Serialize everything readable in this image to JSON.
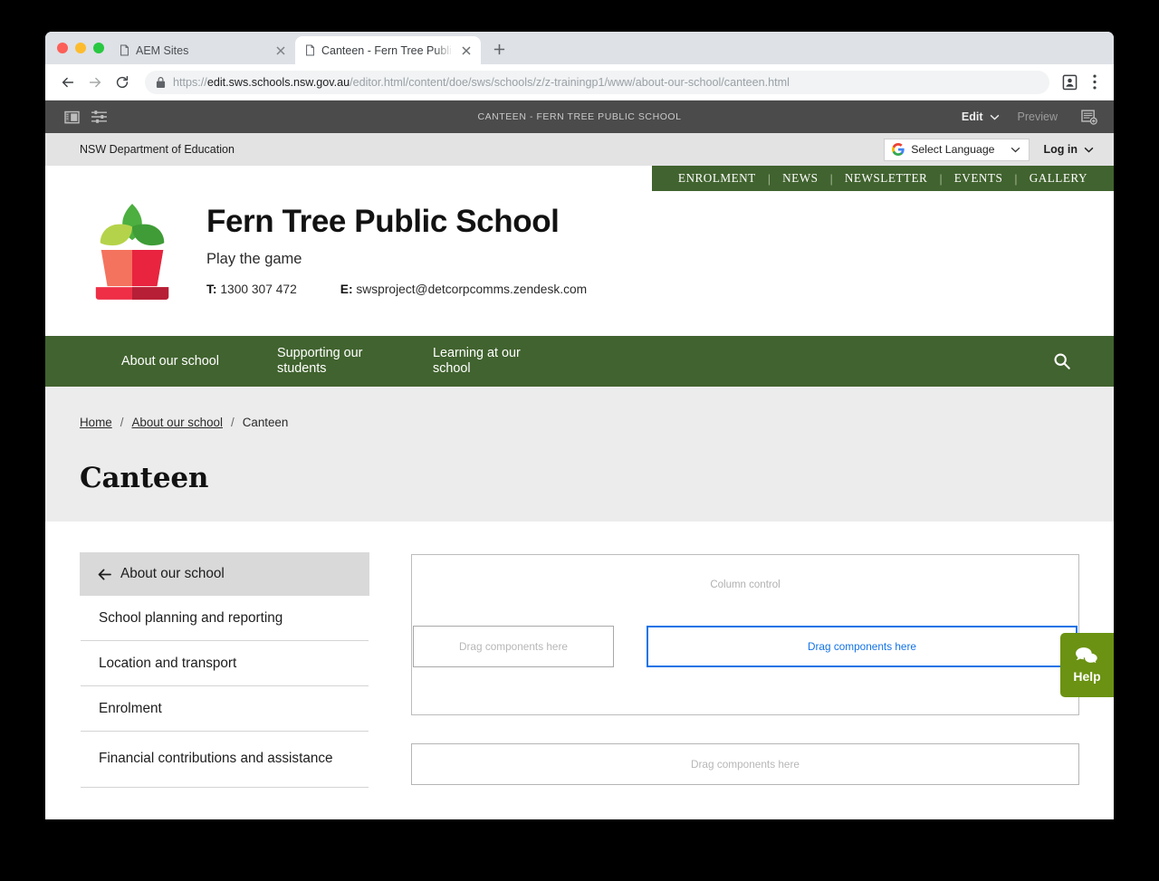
{
  "browser": {
    "tabs": [
      {
        "title": "AEM Sites",
        "active": false
      },
      {
        "title": "Canteen - Fern Tree Public Sch",
        "active": true
      }
    ],
    "new_tab_label": "+",
    "url_prefix": "https://",
    "url_domain": "edit.sws.schools.nsw.gov.au",
    "url_path": "/editor.html/content/doe/sws/schools/z/z-trainingp1/www/about-our-school/canteen.html",
    "url_full": "https://edit.sws.schools.nsw.gov.au/editor.html/content/doe/sws/schools/z/z-trainingp1/www/about-our-school/canteen.html",
    "back_label": "Back",
    "forward_label": "Forward",
    "reload_label": "Reload"
  },
  "aem_toolbar": {
    "title": "CANTEEN - FERN TREE PUBLIC SCHOOL",
    "edit_label": "Edit",
    "preview_label": "Preview"
  },
  "utility_bar": {
    "department": "NSW Department of Education",
    "language_label": "Select Language",
    "login_label": "Log in"
  },
  "quicklinks": [
    "ENROLMENT",
    "NEWS",
    "NEWSLETTER",
    "EVENTS",
    "GALLERY"
  ],
  "school": {
    "name": "Fern Tree Public School",
    "motto": "Play the game",
    "phone_label": "T:",
    "phone": "1300 307 472",
    "email_label": "E:",
    "email": "swsproject@detcorpcomms.zendesk.com"
  },
  "main_nav": [
    {
      "label": "About our school"
    },
    {
      "label": "Supporting our students"
    },
    {
      "label": "Learning at our school"
    }
  ],
  "breadcrumb": [
    {
      "label": "Home",
      "link": true
    },
    {
      "label": "About our school",
      "link": true
    },
    {
      "label": "Canteen",
      "link": false
    }
  ],
  "breadcrumb_separator": "/",
  "page_title": "Canteen",
  "side_nav": {
    "back_label": "About our school",
    "items": [
      {
        "label": "School planning and reporting"
      },
      {
        "label": "Location and transport"
      },
      {
        "label": "Enrolment"
      },
      {
        "label": "Financial contributions and assistance"
      }
    ]
  },
  "editor": {
    "column_control_label": "Column control",
    "dropzone_left": "Drag components here",
    "dropzone_right": "Drag components here",
    "dropzone_bottom": "Drag components here"
  },
  "help": {
    "label": "Help"
  },
  "colors": {
    "brand_green": "#41632f",
    "help_green": "#6b9212",
    "aem_bar": "#4b4b4b",
    "selected_blue": "#1473e6",
    "utility_grey": "#e3e3e3",
    "title_band_grey": "#ececec",
    "logo_leaf_light": "#b5d34a",
    "logo_leaf_mid": "#4caf3f",
    "logo_leaf_dark": "#3f9c36",
    "logo_pot_light": "#f4735e",
    "logo_pot_dark": "#e8243f",
    "logo_base_dark": "#b71f36"
  }
}
